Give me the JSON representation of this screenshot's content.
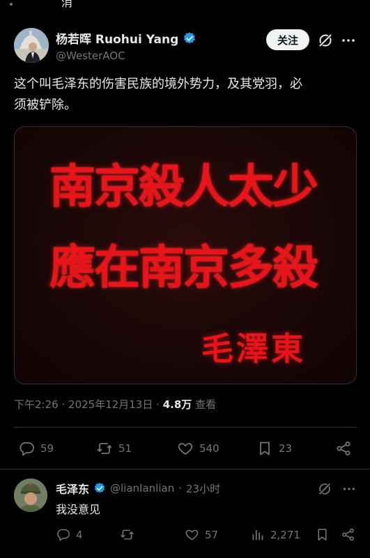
{
  "top_partial": "消",
  "main_post": {
    "author_name": "杨若晖 Ruohui Yang",
    "author_handle": "@WesterAOC",
    "follow_label": "关注",
    "text_line1": "这个叫毛泽东的伤害民族的境外势力，及其党羽，必",
    "text_line2": "须被铲除。",
    "image_text": {
      "line1": "南京殺人太少",
      "line2": "應在南京多殺",
      "signature": "毛澤東"
    },
    "time": "下午2:26",
    "date": "2025年12月13日",
    "views_count": "4.8万",
    "views_label": "查看",
    "separator": "·",
    "stats": {
      "replies": "59",
      "reposts": "51",
      "likes": "540",
      "bookmarks": "23"
    }
  },
  "reply": {
    "author_name": "毛泽东",
    "author_handle": "@lianIanlian",
    "separator": "·",
    "time_ago": "23小时",
    "text": "我没意见",
    "stats": {
      "replies": "4",
      "reposts": "",
      "likes": "57",
      "views": "2,271"
    }
  },
  "colors": {
    "background": "#000000",
    "text_primary": "#e7e9ea",
    "text_secondary": "#71767b",
    "verified_blue": "#1d9bf0",
    "image_red": "#e8141a",
    "divider": "#2f3336"
  },
  "icons": [
    "verified-badge-icon",
    "grok-icon",
    "more-icon",
    "reply-icon",
    "repost-icon",
    "like-icon",
    "bookmark-icon",
    "share-icon",
    "views-icon"
  ]
}
